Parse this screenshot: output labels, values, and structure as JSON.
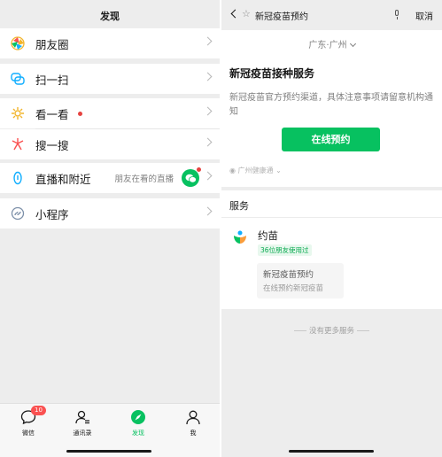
{
  "discover": {
    "title": "发现",
    "items": [
      {
        "label": "朋友圈",
        "icon": "moments-icon"
      },
      {
        "label": "扫一扫",
        "icon": "scan-icon"
      },
      {
        "label": "看一看",
        "icon": "top-stories-icon"
      },
      {
        "label": "搜一搜",
        "icon": "search-icon"
      },
      {
        "label": "直播和附近",
        "icon": "live-nearby-icon",
        "sub": "朋友在看的直播"
      },
      {
        "label": "小程序",
        "icon": "mini-program-icon"
      }
    ]
  },
  "tabbar": {
    "tabs": [
      {
        "label": "微信",
        "badge": "10"
      },
      {
        "label": "通讯录"
      },
      {
        "label": "发现"
      },
      {
        "label": "我"
      }
    ]
  },
  "search": {
    "query": "新冠疫苗预约",
    "cancel": "取消"
  },
  "result": {
    "region": "广东·广州",
    "service_title": "新冠疫苗接种服务",
    "description": "新冠疫苗官方预约渠道，具体注意事项请留意机构通知",
    "book_button": "在线预约",
    "provider": "广州健康通"
  },
  "services": {
    "title": "服务",
    "app_name": "约苗",
    "friends_badge": "36位朋友使用过",
    "subcard_title": "新冠疫苗预约",
    "subcard_desc": "在线预约新冠疫苗"
  },
  "footer": {
    "no_more": "没有更多服务"
  },
  "colors": {
    "accent": "#07c160",
    "badge_red": "#fa5151",
    "background": "#ededed"
  }
}
